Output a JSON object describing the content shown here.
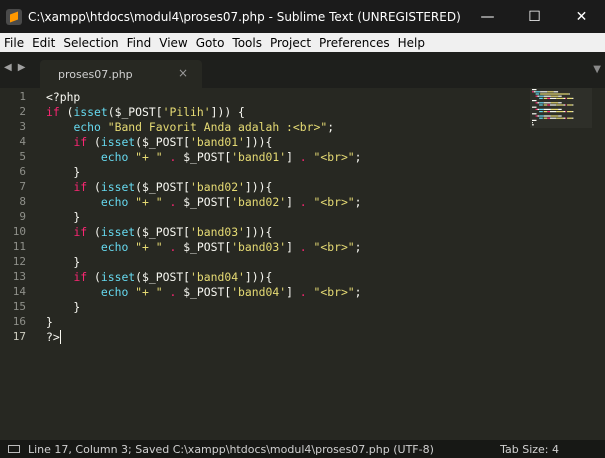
{
  "window": {
    "title": "C:\\xampp\\htdocs\\modul4\\proses07.php - Sublime Text (UNREGISTERED)",
    "minimize_glyph": "—",
    "maximize_glyph": "☐",
    "close_glyph": "✕"
  },
  "menu": {
    "items": [
      "File",
      "Edit",
      "Selection",
      "Find",
      "View",
      "Goto",
      "Tools",
      "Project",
      "Preferences",
      "Help"
    ]
  },
  "tabs": [
    {
      "label": "proses07.php",
      "close_glyph": "×",
      "active": true
    }
  ],
  "tabbar": {
    "prev_glyph": "◀",
    "next_glyph": "▶",
    "overflow_glyph": "▼"
  },
  "editor": {
    "line_numbers": [
      "1",
      "2",
      "3",
      "4",
      "5",
      "6",
      "7",
      "8",
      "9",
      "10",
      "11",
      "12",
      "13",
      "14",
      "15",
      "16",
      "17"
    ],
    "active_line": 17,
    "lines": [
      [
        {
          "t": "<?php",
          "c": "plain"
        }
      ],
      [
        {
          "t": "if",
          "c": "kw"
        },
        {
          "t": " (",
          "c": "plain"
        },
        {
          "t": "isset",
          "c": "fn"
        },
        {
          "t": "($_POST[",
          "c": "plain"
        },
        {
          "t": "'Pilih'",
          "c": "str"
        },
        {
          "t": "])) {",
          "c": "plain"
        }
      ],
      [
        {
          "t": "    ",
          "c": "plain"
        },
        {
          "t": "echo",
          "c": "fn"
        },
        {
          "t": " ",
          "c": "plain"
        },
        {
          "t": "\"Band Favorit Anda adalah :<br>\"",
          "c": "str"
        },
        {
          "t": ";",
          "c": "plain"
        }
      ],
      [
        {
          "t": "    ",
          "c": "plain"
        },
        {
          "t": "if",
          "c": "kw"
        },
        {
          "t": " (",
          "c": "plain"
        },
        {
          "t": "isset",
          "c": "fn"
        },
        {
          "t": "($_POST[",
          "c": "plain"
        },
        {
          "t": "'band01'",
          "c": "str"
        },
        {
          "t": "])){",
          "c": "plain"
        }
      ],
      [
        {
          "t": "        ",
          "c": "plain"
        },
        {
          "t": "echo",
          "c": "fn"
        },
        {
          "t": " ",
          "c": "plain"
        },
        {
          "t": "\"+ \"",
          "c": "str"
        },
        {
          "t": " . ",
          "c": "op"
        },
        {
          "t": "$_POST[",
          "c": "plain"
        },
        {
          "t": "'band01'",
          "c": "str"
        },
        {
          "t": "] ",
          "c": "plain"
        },
        {
          "t": ".",
          "c": "op"
        },
        {
          "t": " ",
          "c": "plain"
        },
        {
          "t": "\"<br>\"",
          "c": "str"
        },
        {
          "t": ";",
          "c": "plain"
        }
      ],
      [
        {
          "t": "    }",
          "c": "plain"
        }
      ],
      [
        {
          "t": "    ",
          "c": "plain"
        },
        {
          "t": "if",
          "c": "kw"
        },
        {
          "t": " (",
          "c": "plain"
        },
        {
          "t": "isset",
          "c": "fn"
        },
        {
          "t": "($_POST[",
          "c": "plain"
        },
        {
          "t": "'band02'",
          "c": "str"
        },
        {
          "t": "])){",
          "c": "plain"
        }
      ],
      [
        {
          "t": "        ",
          "c": "plain"
        },
        {
          "t": "echo",
          "c": "fn"
        },
        {
          "t": " ",
          "c": "plain"
        },
        {
          "t": "\"+ \"",
          "c": "str"
        },
        {
          "t": " . ",
          "c": "op"
        },
        {
          "t": "$_POST[",
          "c": "plain"
        },
        {
          "t": "'band02'",
          "c": "str"
        },
        {
          "t": "] ",
          "c": "plain"
        },
        {
          "t": ".",
          "c": "op"
        },
        {
          "t": " ",
          "c": "plain"
        },
        {
          "t": "\"<br>\"",
          "c": "str"
        },
        {
          "t": ";",
          "c": "plain"
        }
      ],
      [
        {
          "t": "    }",
          "c": "plain"
        }
      ],
      [
        {
          "t": "    ",
          "c": "plain"
        },
        {
          "t": "if",
          "c": "kw"
        },
        {
          "t": " (",
          "c": "plain"
        },
        {
          "t": "isset",
          "c": "fn"
        },
        {
          "t": "($_POST[",
          "c": "plain"
        },
        {
          "t": "'band03'",
          "c": "str"
        },
        {
          "t": "])){",
          "c": "plain"
        }
      ],
      [
        {
          "t": "        ",
          "c": "plain"
        },
        {
          "t": "echo",
          "c": "fn"
        },
        {
          "t": " ",
          "c": "plain"
        },
        {
          "t": "\"+ \"",
          "c": "str"
        },
        {
          "t": " . ",
          "c": "op"
        },
        {
          "t": "$_POST[",
          "c": "plain"
        },
        {
          "t": "'band03'",
          "c": "str"
        },
        {
          "t": "] ",
          "c": "plain"
        },
        {
          "t": ".",
          "c": "op"
        },
        {
          "t": " ",
          "c": "plain"
        },
        {
          "t": "\"<br>\"",
          "c": "str"
        },
        {
          "t": ";",
          "c": "plain"
        }
      ],
      [
        {
          "t": "    }",
          "c": "plain"
        }
      ],
      [
        {
          "t": "    ",
          "c": "plain"
        },
        {
          "t": "if",
          "c": "kw"
        },
        {
          "t": " (",
          "c": "plain"
        },
        {
          "t": "isset",
          "c": "fn"
        },
        {
          "t": "($_POST[",
          "c": "plain"
        },
        {
          "t": "'band04'",
          "c": "str"
        },
        {
          "t": "])){",
          "c": "plain"
        }
      ],
      [
        {
          "t": "        ",
          "c": "plain"
        },
        {
          "t": "echo",
          "c": "fn"
        },
        {
          "t": " ",
          "c": "plain"
        },
        {
          "t": "\"+ \"",
          "c": "str"
        },
        {
          "t": " . ",
          "c": "op"
        },
        {
          "t": "$_POST[",
          "c": "plain"
        },
        {
          "t": "'band04'",
          "c": "str"
        },
        {
          "t": "] ",
          "c": "plain"
        },
        {
          "t": ".",
          "c": "op"
        },
        {
          "t": " ",
          "c": "plain"
        },
        {
          "t": "\"<br>\"",
          "c": "str"
        },
        {
          "t": ";",
          "c": "plain"
        }
      ],
      [
        {
          "t": "    }",
          "c": "plain"
        }
      ],
      [
        {
          "t": "}",
          "c": "plain"
        }
      ],
      [
        {
          "t": "?>",
          "c": "plain"
        }
      ]
    ]
  },
  "status": {
    "text": "Line 17, Column 3; Saved C:\\xampp\\htdocs\\modul4\\proses07.php (UTF-8)",
    "tab_size": "Tab Size: 4"
  },
  "colors": {
    "background": "#272822",
    "keyword": "#f92672",
    "function": "#66d9ef",
    "string": "#e6db74",
    "text": "#f8f8f2"
  }
}
